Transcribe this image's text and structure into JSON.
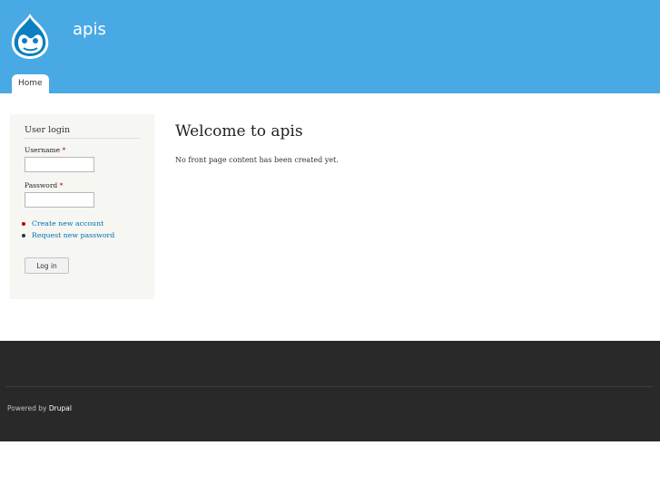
{
  "header": {
    "site_name": "apis",
    "logo_icon": "drupal-drop-logo",
    "background": "#48a9e4"
  },
  "nav": {
    "tabs": [
      {
        "label": "Home",
        "active": true
      }
    ]
  },
  "sidebar": {
    "user_login": {
      "title": "User login",
      "username_label": "Username",
      "password_label": "Password",
      "required_marker": "*",
      "username_value": "",
      "password_value": "",
      "links": [
        {
          "label": "Create new account",
          "bullet_color": "#c00000"
        },
        {
          "label": "Request new password",
          "bullet_color": "#333333"
        }
      ],
      "login_button": "Log in"
    }
  },
  "main": {
    "title": "Welcome to apis",
    "message": "No front page content has been created yet."
  },
  "footer": {
    "powered_prefix": "Powered by",
    "powered_link": "Drupal",
    "background": "#292929"
  }
}
